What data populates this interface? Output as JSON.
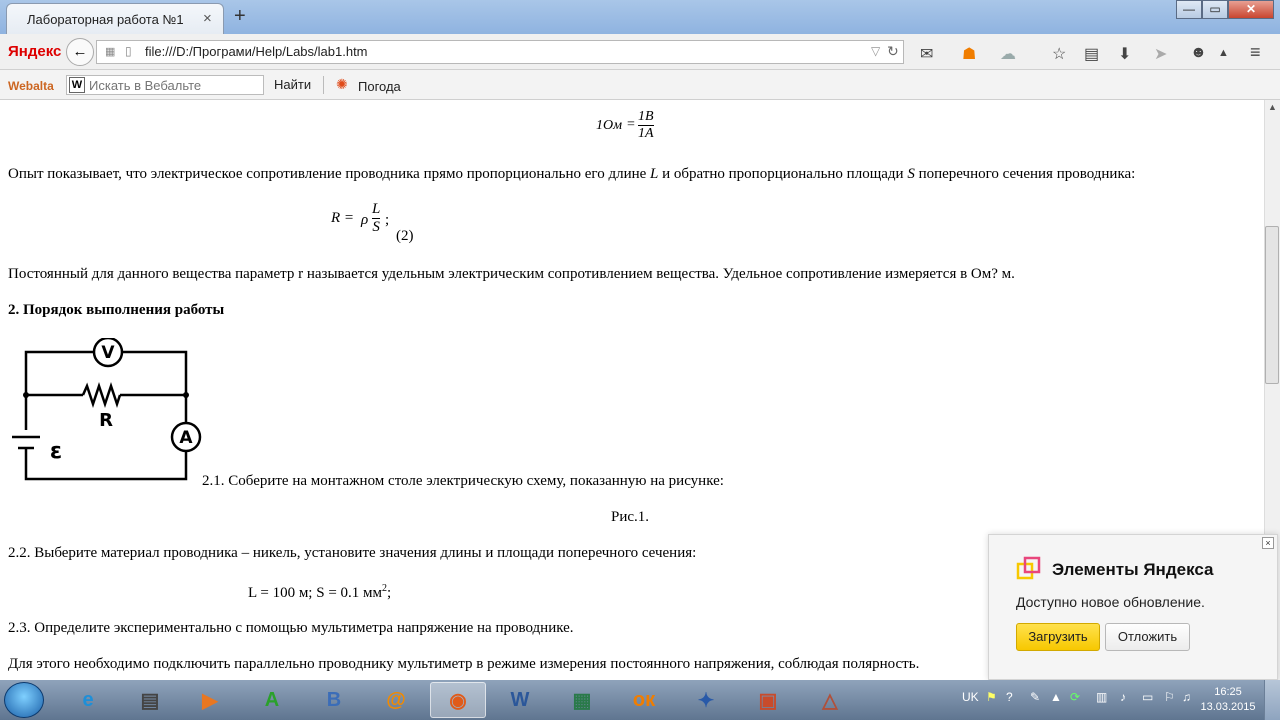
{
  "browser": {
    "tab_title": "Лабораторная работа №1",
    "tab_close": "×",
    "new_tab": "+",
    "window_buttons": [
      "—",
      "▭",
      "✕"
    ],
    "logo": "Яндекс",
    "url": "file:///D:/Програми/Help/Labs/lab1.htm",
    "back_icon": "←",
    "nav_icons": [
      "mail-icon",
      "odnoklassniki-icon",
      "weather-icon",
      "star-icon",
      "reading-list-icon",
      "download-icon",
      "send-icon",
      "smile-icon",
      "home-icon",
      "menu-icon"
    ]
  },
  "bookmarks": {
    "logo": "Webalta",
    "search_placeholder": "Искать в Вебальте",
    "search_badge": "W",
    "find_label": "Найти",
    "weather_label": "Погода"
  },
  "content": {
    "formula_unit": {
      "lhs": "1Ом",
      "eq": "=",
      "num": "1В",
      "den": "1А"
    },
    "para1_a": "Опыт показывает, что электрическое сопротивление проводника прямо пропорционально его длине ",
    "para1_L": "L",
    "para1_b": " и обратно пропорционально площади ",
    "para1_S": "S",
    "para1_c": " поперечного сечения проводника:",
    "formula_r": {
      "lhs": "R =",
      "rho": "ρ",
      "num": "L",
      "den": "S",
      "tail": ";",
      "number": "(2)"
    },
    "para2": "Постоянный для данного вещества параметр r называется удельным электрическим сопротивлением вещества. Удельное сопротивление измеряется в Ом? м.",
    "section_title": "2. Порядок выполнения работы",
    "circuit_labels": {
      "voltmeter": "V",
      "ammeter": "A",
      "resistor": "R",
      "source": "ε"
    },
    "step_2_1": "2.1. Соберите на монтажном столе электрическую схему, показанную на рисунке:",
    "fig_caption": "Рис.1.",
    "step_2_2": "2.2. Выберите материал проводника – никель, установите значения длины и площади поперечного сечения:",
    "values_line": "L = 100 м; S = 0.1 мм",
    "values_sup": "2",
    "values_tail": ";",
    "step_2_3": "2.3. Определите экспериментально с помощью мультиметра напряжение на проводнике.",
    "para3": "Для этого необходимо подключить параллельно проводнику мультиметр в режиме измерения постоянного напряжения, соблюдая полярность."
  },
  "notification": {
    "title": "Элементы Яндекса",
    "message": "Доступно новое обновление.",
    "load_button": "Загрузить",
    "later_button": "Отложить",
    "close": "×"
  },
  "taskbar": {
    "items": [
      "ie-icon",
      "film-icon",
      "media-player-icon",
      "a-icon",
      "vk-icon",
      "mail-agent-icon",
      "firefox-icon",
      "word-icon",
      "monitor-icon",
      "odnoklassniki-icon",
      "wings-icon",
      "powerpoint-icon",
      "triangle-icon"
    ],
    "item_glyphs": [
      "e",
      "▤",
      "▶",
      "A",
      "B",
      "@",
      "◉",
      "W",
      "▦",
      "ок",
      "✦",
      "▣",
      "△"
    ],
    "lang": "UK",
    "time": "16:25",
    "date": "13.03.2015"
  }
}
